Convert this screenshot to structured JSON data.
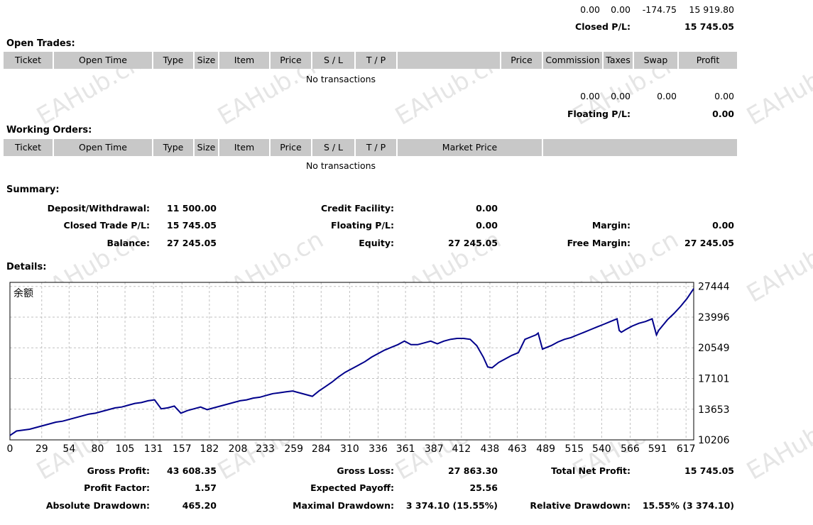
{
  "top_totals": {
    "row_values": [
      "0.00",
      "0.00",
      "-174.75",
      "15 919.80"
    ],
    "closed_pl_label": "Closed P/L:",
    "closed_pl_value": "15 745.05"
  },
  "open_trades": {
    "title": "Open Trades:",
    "columns": [
      "Ticket",
      "Open Time",
      "Type",
      "Size",
      "Item",
      "Price",
      "S / L",
      "T / P",
      "",
      "Price",
      "Commission",
      "Taxes",
      "Swap",
      "Profit"
    ],
    "empty_text": "No transactions",
    "totals": [
      "0.00",
      "0.00",
      "0.00",
      "0.00"
    ],
    "floating_pl_label": "Floating P/L:",
    "floating_pl_value": "0.00"
  },
  "working_orders": {
    "title": "Working Orders:",
    "columns": [
      "Ticket",
      "Open Time",
      "Type",
      "Size",
      "Item",
      "Price",
      "S / L",
      "T / P",
      "Market Price",
      ""
    ],
    "empty_text": "No transactions"
  },
  "summary": {
    "title": "Summary:",
    "deposit_label": "Deposit/Withdrawal:",
    "deposit_value": "11 500.00",
    "credit_label": "Credit Facility:",
    "credit_value": "0.00",
    "closed_label": "Closed Trade P/L:",
    "closed_value": "15 745.05",
    "floating_label": "Floating P/L:",
    "floating_value": "0.00",
    "margin_label": "Margin:",
    "margin_value": "0.00",
    "balance_label": "Balance:",
    "balance_value": "27 245.05",
    "equity_label": "Equity:",
    "equity_value": "27 245.05",
    "free_margin_label": "Free Margin:",
    "free_margin_value": "27 245.05"
  },
  "details": {
    "title": "Details:",
    "chart_legend": "余额",
    "gross_profit_label": "Gross Profit:",
    "gross_profit_value": "43 608.35",
    "gross_loss_label": "Gross Loss:",
    "gross_loss_value": "27 863.30",
    "total_net_label": "Total Net Profit:",
    "total_net_value": "15 745.05",
    "profit_factor_label": "Profit Factor:",
    "profit_factor_value": "1.57",
    "expected_payoff_label": "Expected Payoff:",
    "expected_payoff_value": "25.56",
    "abs_dd_label": "Absolute Drawdown:",
    "abs_dd_value": "465.20",
    "max_dd_label": "Maximal Drawdown:",
    "max_dd_value": "3 374.10 (15.55%)",
    "rel_dd_label": "Relative Drawdown:",
    "rel_dd_value": "15.55% (3 374.10)"
  },
  "watermark_text": "EAHub.cn",
  "colors": {
    "header_bg": "#c8c8c8",
    "line": "#00008b",
    "grid": "#c0c0c0"
  },
  "chart_data": {
    "type": "line",
    "series": [
      {
        "name": "余额",
        "x": [
          0,
          6,
          12,
          18,
          24,
          30,
          36,
          42,
          48,
          54,
          60,
          66,
          72,
          78,
          84,
          90,
          96,
          102,
          108,
          114,
          120,
          126,
          132,
          138,
          144,
          150,
          156,
          162,
          168,
          174,
          180,
          186,
          192,
          198,
          204,
          210,
          216,
          222,
          228,
          234,
          240,
          246,
          252,
          258,
          264,
          270,
          276,
          282,
          288,
          294,
          300,
          306,
          312,
          318,
          324,
          330,
          336,
          342,
          348,
          354,
          360,
          366,
          372,
          378,
          384,
          390,
          396,
          402,
          408,
          414,
          420,
          426,
          432,
          436,
          440,
          446,
          452,
          458,
          464,
          470,
          476,
          480,
          482,
          486,
          490,
          494,
          500,
          506,
          512,
          518,
          524,
          530,
          536,
          542,
          548,
          554,
          556,
          558,
          562,
          568,
          574,
          580,
          586,
          590,
          592,
          596,
          600,
          606,
          612,
          618,
          624
        ],
        "y": [
          10700,
          11200,
          11300,
          11400,
          11600,
          11800,
          12000,
          12200,
          12300,
          12500,
          12700,
          12900,
          13100,
          13200,
          13400,
          13600,
          13800,
          13900,
          14100,
          14300,
          14400,
          14600,
          14700,
          13700,
          13800,
          14000,
          13200,
          13500,
          13700,
          13900,
          13600,
          13800,
          14000,
          14200,
          14400,
          14600,
          14700,
          14900,
          15000,
          15200,
          15400,
          15500,
          15600,
          15700,
          15500,
          15300,
          15100,
          15700,
          16200,
          16700,
          17300,
          17800,
          18200,
          18600,
          19000,
          19500,
          19900,
          20300,
          20600,
          20900,
          21300,
          20900,
          20900,
          21100,
          21300,
          21000,
          21300,
          21500,
          21600,
          21600,
          21500,
          20800,
          19500,
          18400,
          18300,
          18900,
          19300,
          19700,
          20000,
          21500,
          21800,
          22000,
          22200,
          20400,
          20600,
          20800,
          21200,
          21500,
          21700,
          22000,
          22300,
          22600,
          22900,
          23200,
          23500,
          23800,
          22500,
          22300,
          22600,
          23000,
          23300,
          23500,
          23800,
          22000,
          22500,
          23100,
          23700,
          24400,
          25200,
          26100,
          27200
        ]
      }
    ],
    "x_ticks": [
      0,
      29,
      54,
      80,
      105,
      131,
      157,
      182,
      208,
      233,
      259,
      284,
      310,
      336,
      361,
      387,
      412,
      438,
      463,
      489,
      515,
      540,
      566,
      591,
      617
    ],
    "y_ticks": [
      10206,
      13653,
      17101,
      20549,
      23996,
      27444
    ],
    "xlim": [
      0,
      624
    ],
    "ylim": [
      10206,
      27900
    ],
    "grid": true,
    "legend": "top-left"
  }
}
